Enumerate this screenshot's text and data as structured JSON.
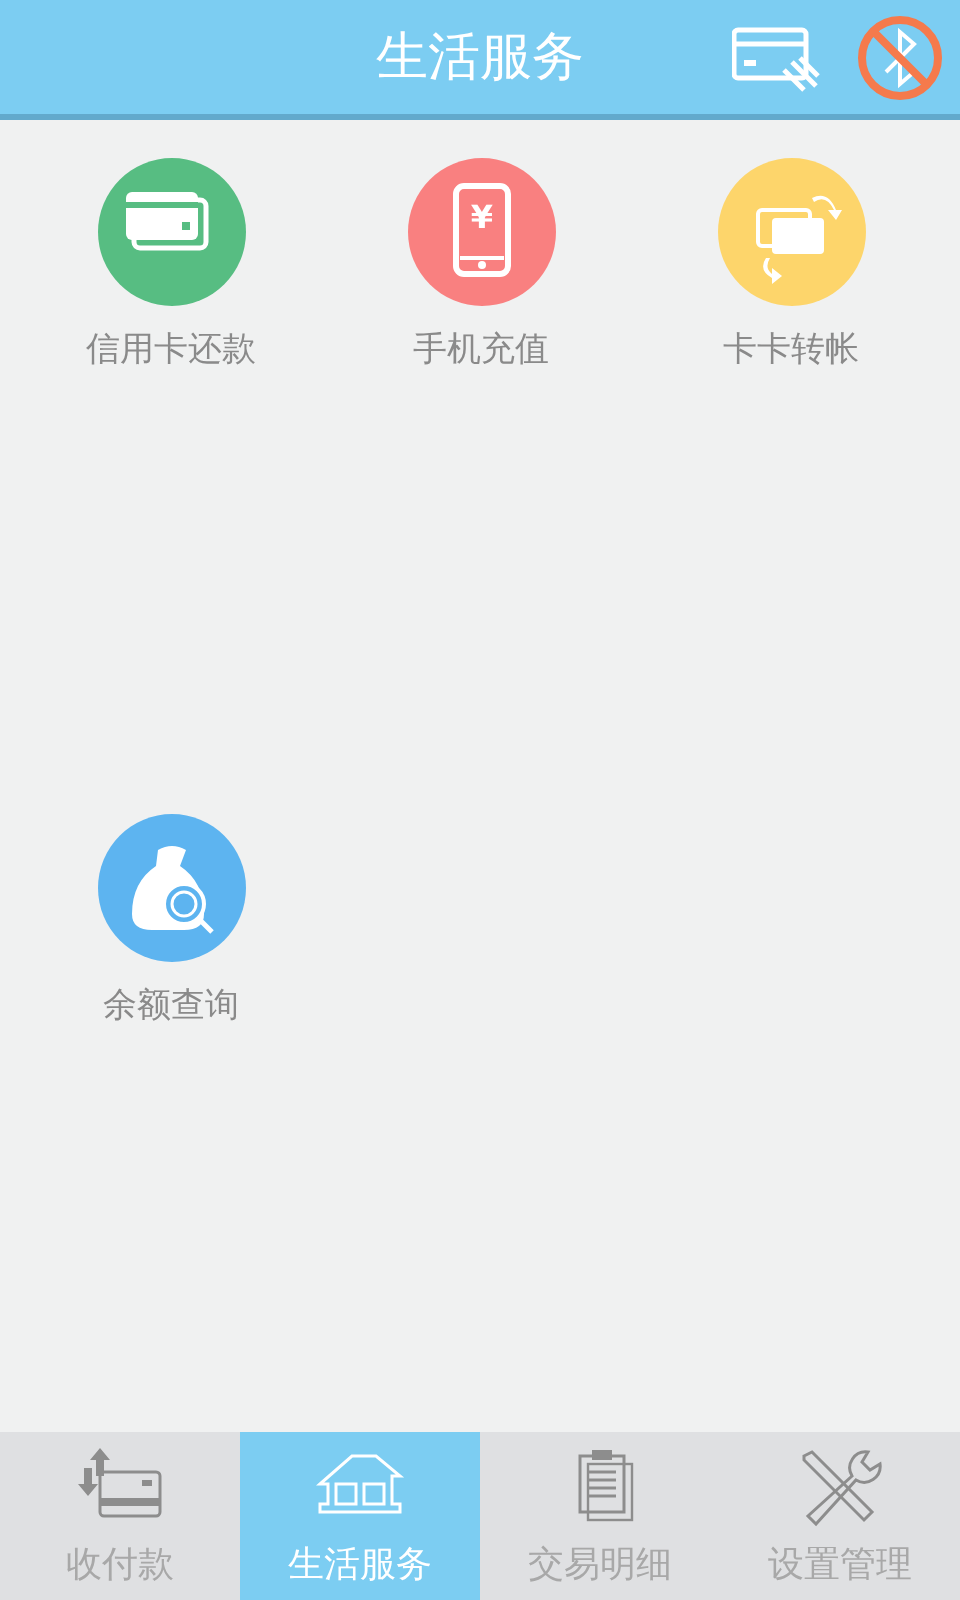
{
  "header": {
    "title": "生活服务"
  },
  "services": [
    {
      "label": "信用卡还款",
      "kind": "card",
      "color": "#57bd82"
    },
    {
      "label": "手机充值",
      "kind": "phone",
      "color": "#f98080",
      "symbol": "¥"
    },
    {
      "label": "卡卡转帐",
      "kind": "transfer",
      "color": "#fdd56b"
    },
    {
      "label": "余额查询",
      "kind": "balance",
      "color": "#5db4f0"
    }
  ],
  "tabs": [
    {
      "label": "收付款",
      "kind": "pay",
      "selected": false
    },
    {
      "label": "生活服务",
      "kind": "home",
      "selected": true
    },
    {
      "label": "交易明细",
      "kind": "list",
      "selected": false
    },
    {
      "label": "设置管理",
      "kind": "settings",
      "selected": false
    }
  ]
}
